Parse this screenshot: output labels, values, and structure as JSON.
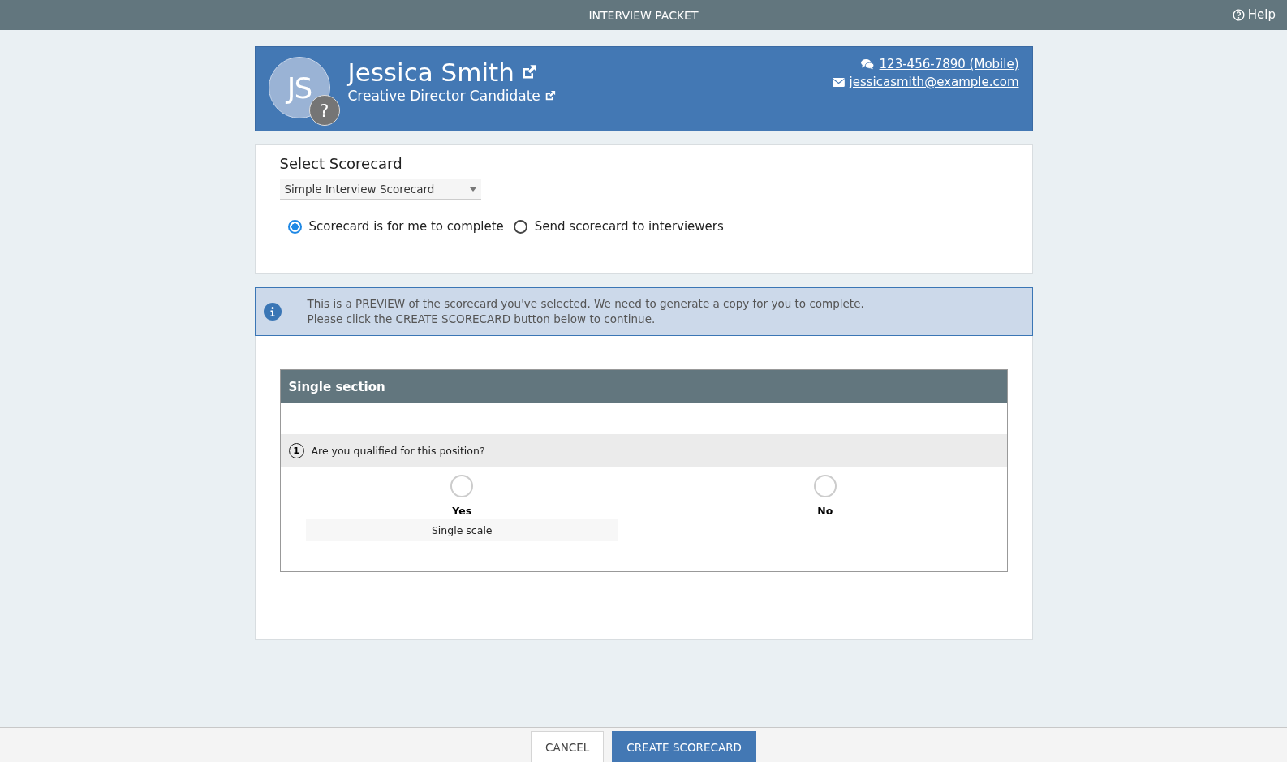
{
  "app_bar": {
    "title": "INTERVIEW PACKET",
    "help": "Help"
  },
  "candidate": {
    "initials": "JS",
    "avatar_badge": "?",
    "name": "Jessica Smith",
    "role": "Creative Director Candidate",
    "phone": "123-456-7890 (Mobile)",
    "email": "jessicasmith@example.com"
  },
  "scorecard_select": {
    "heading": "Select Scorecard",
    "value": "Simple Interview Scorecard",
    "options": [
      {
        "label": "Scorecard is for me to complete",
        "selected": true
      },
      {
        "label": "Send scorecard to interviewers",
        "selected": false
      }
    ]
  },
  "notice": {
    "lines": [
      "This is a PREVIEW of the scorecard you've selected. We need to generate a copy for you to complete.",
      "Please click the CREATE SCORECARD button below to continue."
    ]
  },
  "section": {
    "title": "Single section",
    "questions": [
      {
        "number": "1",
        "text": "Are you qualified for this position?",
        "choices": [
          {
            "label": "Yes",
            "selected": false
          },
          {
            "label": "No",
            "selected": false
          }
        ],
        "scale_label": "Single scale"
      }
    ]
  },
  "footer": {
    "buttons": [
      {
        "label": "CANCEL",
        "kind": "secondary"
      },
      {
        "label": "CREATE SCORECARD",
        "kind": "primary"
      }
    ]
  }
}
